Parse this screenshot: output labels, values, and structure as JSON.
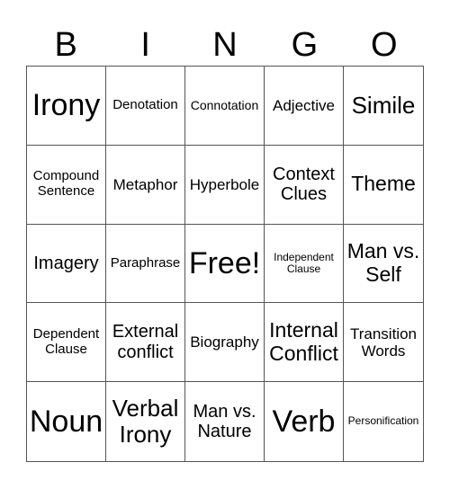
{
  "header": [
    "B",
    "I",
    "N",
    "G",
    "O"
  ],
  "cells": [
    "Irony",
    "Denotation",
    "Connotation",
    "Adjective",
    "Simile",
    "Compound Sentence",
    "Metaphor",
    "Hyperbole",
    "Context Clues",
    "Theme",
    "Imagery",
    "Paraphrase",
    "Free!",
    "Independent Clause",
    "Man vs. Self",
    "Dependent Clause",
    "External conflict",
    "Biography",
    "Internal Conflict",
    "Transition Words",
    "Noun",
    "Verbal Irony",
    "Man vs. Nature",
    "Verb",
    "Personification"
  ]
}
